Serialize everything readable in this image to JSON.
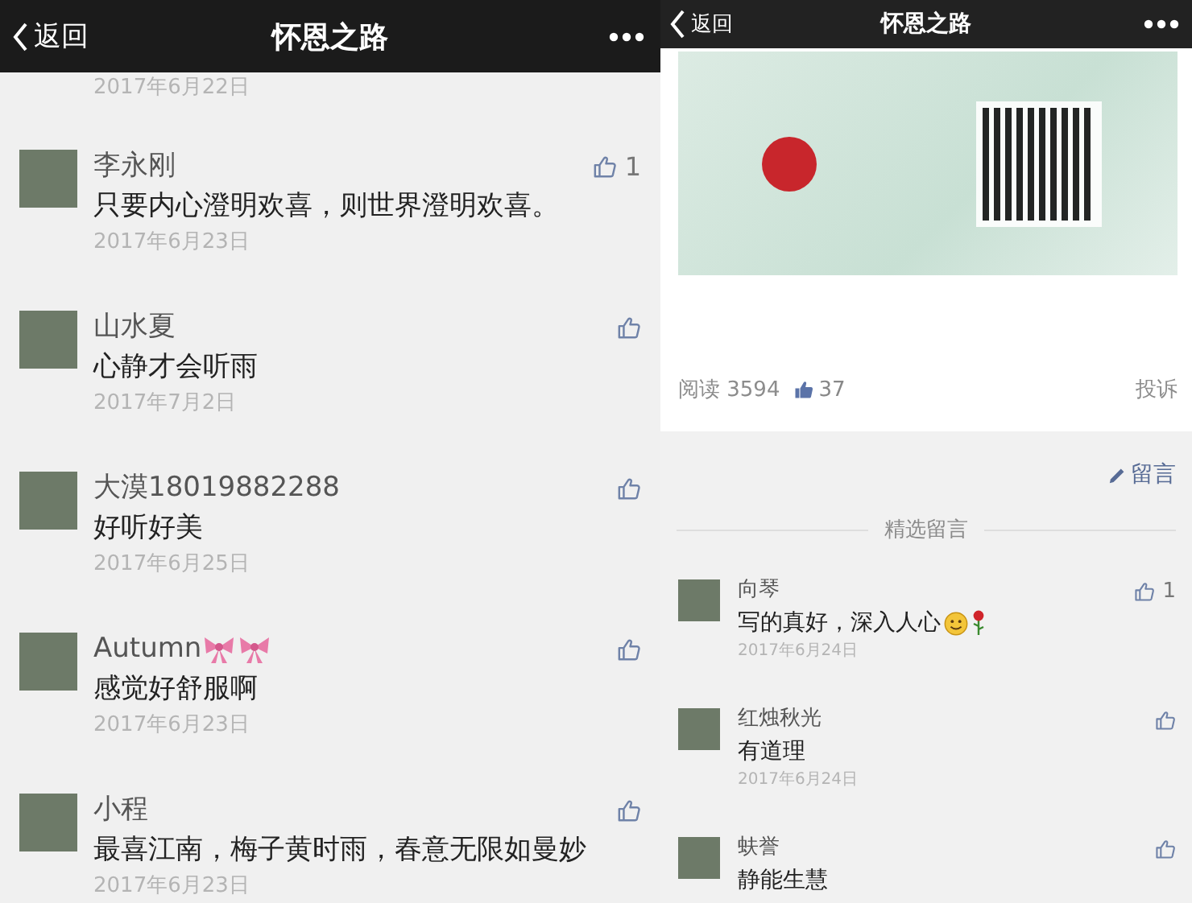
{
  "left_screen": {
    "nav_bar": {
      "back_label": "返回",
      "title": "怀恩之路"
    },
    "previous_comment_date": "2017年6月22日",
    "comments": [
      {
        "name": "李永刚",
        "text": "只要内心澄明欢喜，则世界澄明欢喜。",
        "date": "2017年6月23日",
        "likes": "1"
      },
      {
        "name": "山水夏",
        "text": "心静才会听雨",
        "date": "2017年7月2日"
      },
      {
        "name": "大漠18019882288",
        "text": "好听好美",
        "date": "2017年6月25日"
      },
      {
        "name": "Autumn",
        "name_emojis": [
          {
            "kind": "ribbon"
          },
          {
            "kind": "ribbon"
          }
        ],
        "text": "感觉好舒服啊",
        "date": "2017年6月23日"
      },
      {
        "name": "小程",
        "text": "最喜江南，梅子黄时雨，春意无限如曼妙",
        "date": "2017年6月23日"
      }
    ]
  },
  "right_screen": {
    "nav_bar": {
      "back_label": "返回",
      "title": "怀恩之路"
    },
    "article_stats": {
      "reads": "阅读 3594",
      "likes": "37",
      "report": "投诉"
    },
    "write_comment": "留言",
    "section_title": "精选留言",
    "comments": [
      {
        "name": "向琴",
        "text": "写的真好，深入人心",
        "text_emojis": [
          {
            "kind": "smile"
          },
          {
            "kind": "rose"
          }
        ],
        "date": "2017年6月24日",
        "likes": "1"
      },
      {
        "name": "红烛秋光",
        "text": "有道理",
        "date": "2017年6月24日"
      },
      {
        "name": "蚨誉",
        "text": "静能生慧"
      }
    ]
  }
}
